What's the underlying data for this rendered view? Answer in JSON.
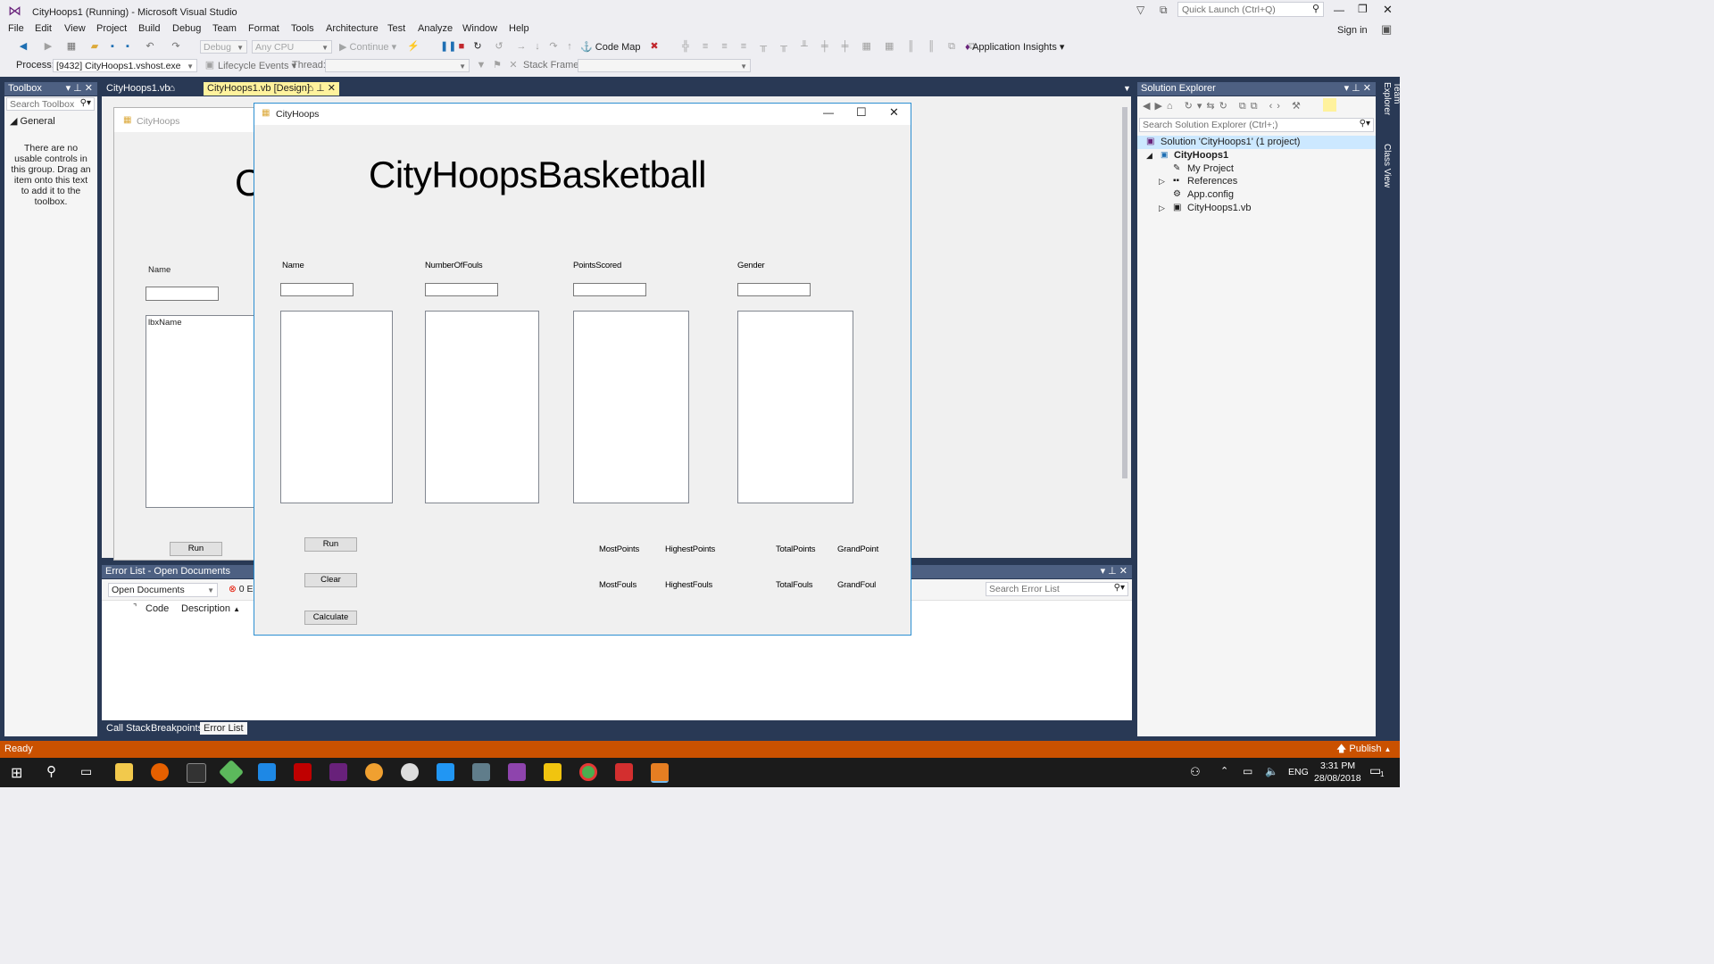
{
  "app": {
    "title": "CityHoops1 (Running) - Microsoft Visual Studio",
    "quick_launch_placeholder": "Quick Launch (Ctrl+Q)",
    "sign_in": "Sign in"
  },
  "menu": [
    "File",
    "Edit",
    "View",
    "Project",
    "Build",
    "Debug",
    "Team",
    "Format",
    "Tools",
    "Architecture",
    "Test",
    "Analyze",
    "Window",
    "Help"
  ],
  "toolbar": {
    "config": "Debug",
    "platform": "Any CPU",
    "continue": "Continue",
    "code_map": "Code Map",
    "app_insights": "Application Insights",
    "process_label": "Process:",
    "process_value": "[9432] CityHoops1.vshost.exe",
    "lifecycle": "Lifecycle Events",
    "thread_label": "Thread:",
    "stack_frame_label": "Stack Frame:"
  },
  "toolbox": {
    "title": "Toolbox",
    "search_placeholder": "Search Toolbox",
    "group": "General",
    "empty_message": "There are no usable controls in this group. Drag an item onto this text to add it to the toolbox."
  },
  "doc_tabs": [
    {
      "label": "CityHoops1.vb",
      "active": false
    },
    {
      "label": "CityHoops1.vb [Design]",
      "active": true
    }
  ],
  "designer": {
    "form_title": "CityHoops",
    "big_letter": "C",
    "name_label": "Name",
    "listbox_text": "lbxName",
    "run_button": "Run"
  },
  "error_list": {
    "title": "Error List - Open Documents",
    "scope": "Open Documents",
    "errors_badge": "0 E",
    "col_code": "Code",
    "col_description": "Description",
    "search_placeholder": "Search Error List"
  },
  "bottom_tabs": [
    "Call Stack",
    "Breakpoints",
    "Error List"
  ],
  "solution_explorer": {
    "title": "Solution Explorer",
    "search_placeholder": "Search Solution Explorer (Ctrl+;)",
    "solution": "Solution 'CityHoops1' (1 project)",
    "project": "CityHoops1",
    "items": [
      "My Project",
      "References",
      "App.config",
      "CityHoops1.vb"
    ]
  },
  "side_tabs": [
    "Team Explorer",
    "Class View"
  ],
  "running_form": {
    "title": "CityHoops",
    "heading": "CityHoopsBasketball",
    "columns": [
      "Name",
      "NumberOfFouls",
      "PointsScored",
      "Gender"
    ],
    "buttons": [
      "Run",
      "Clear",
      "Calculate"
    ],
    "stats_row1": [
      "MostPoints",
      "HighestPoints",
      "TotalPoints",
      "GrandPoint"
    ],
    "stats_row2": [
      "MostFouls",
      "HighestFouls",
      "TotalFouls",
      "GrandFoul"
    ]
  },
  "status": {
    "text": "Ready",
    "publish": "Publish"
  },
  "taskbar": {
    "lang": "ENG",
    "time": "3:31 PM",
    "date": "28/08/2018",
    "notifications": "1"
  }
}
